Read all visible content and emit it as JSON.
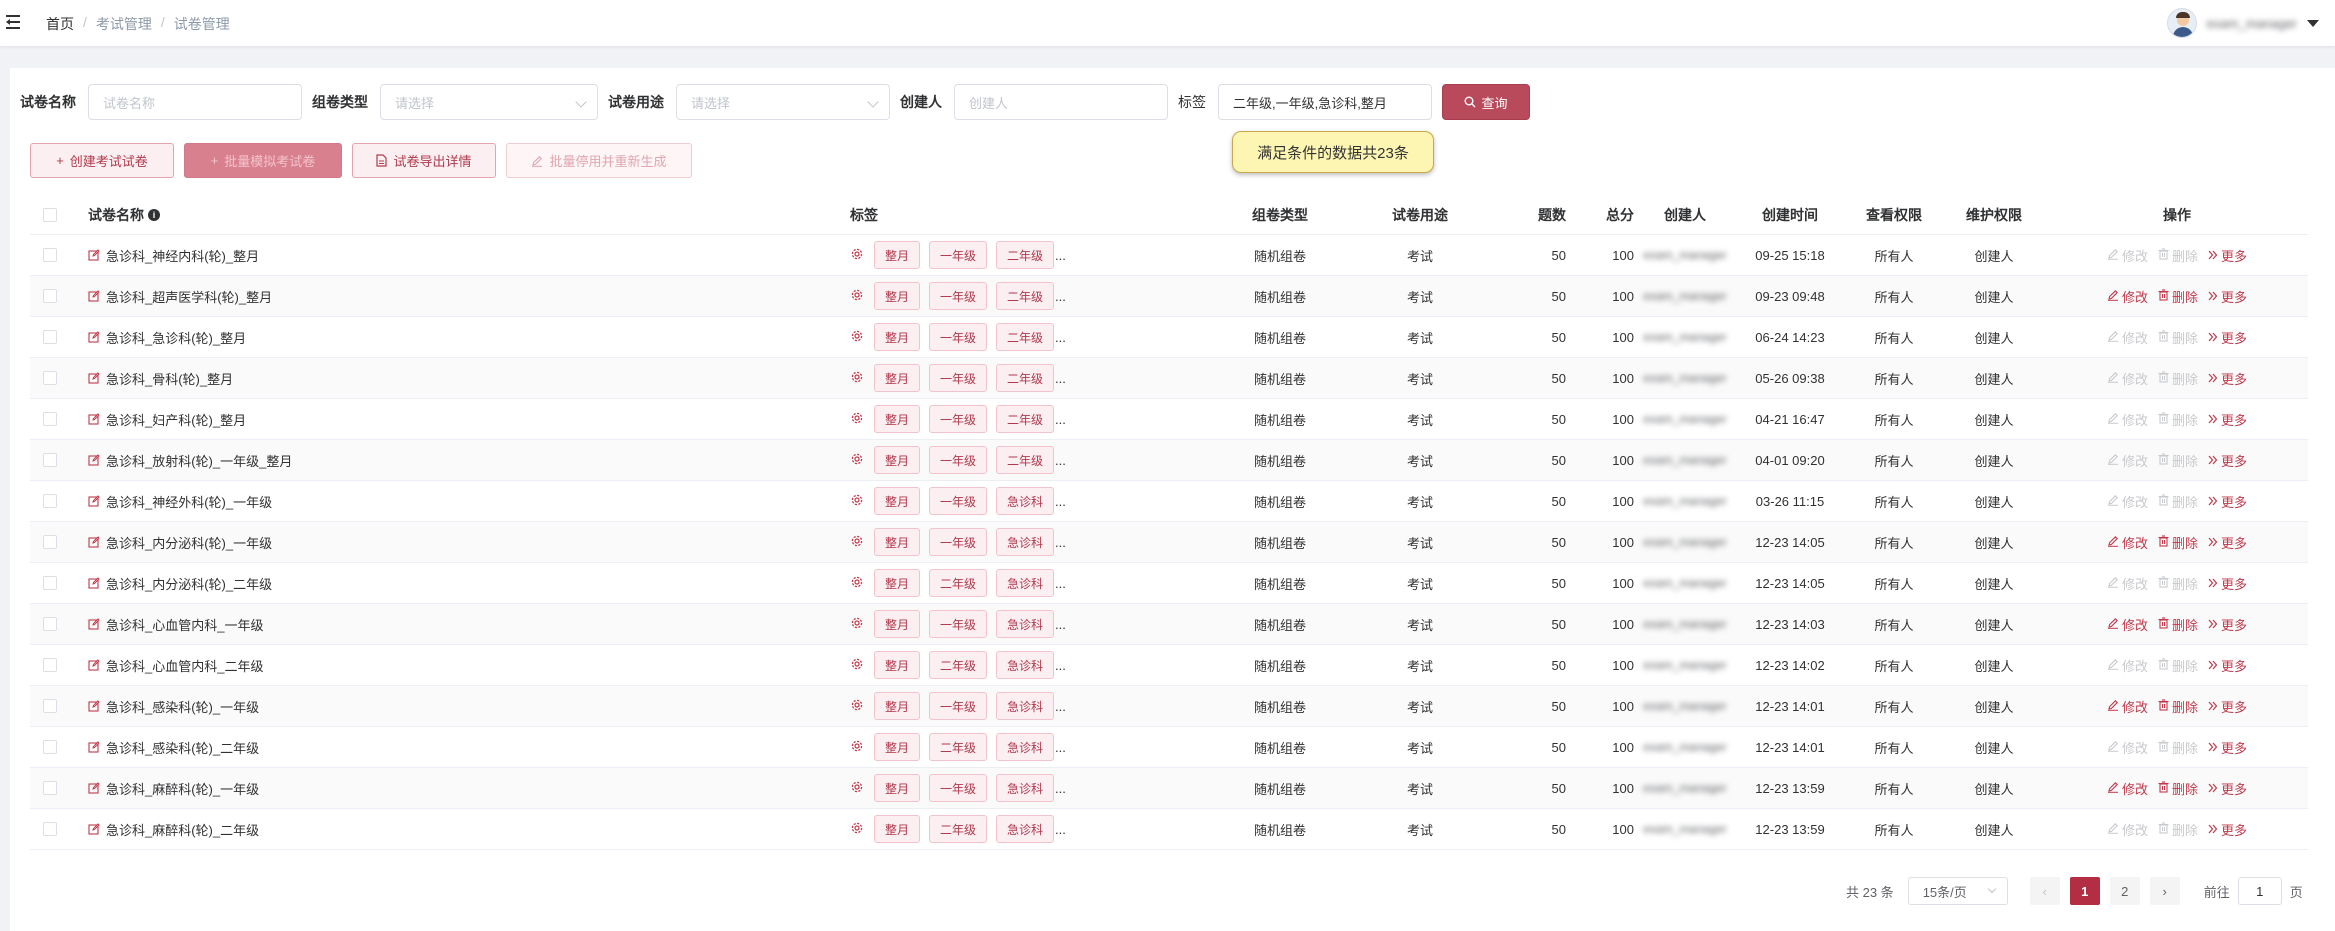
{
  "breadcrumb": {
    "home": "首页",
    "level1": "考试管理",
    "level2": "试卷管理"
  },
  "user": {
    "name": "exam_manager"
  },
  "filters": {
    "name_label": "试卷名称",
    "name_placeholder": "试卷名称",
    "compose_label": "组卷类型",
    "compose_placeholder": "请选择",
    "use_label": "试卷用途",
    "use_placeholder": "请选择",
    "creator_label": "创建人",
    "creator_placeholder": "创建人",
    "tag_label": "标签",
    "tag_value": "二年级,一年级,急诊科,整月",
    "query_label": "查询"
  },
  "tooltip": "满足条件的数据共23条",
  "actions": {
    "create_exam": "创建考试试卷",
    "create_mock": "批量模拟考试卷",
    "export": "试卷导出详情",
    "batch_disable": "批量停用并重新生成"
  },
  "columns": {
    "name": "试卷名称",
    "tags": "标签",
    "type": "组卷类型",
    "use": "试卷用途",
    "count": "题数",
    "score": "总分",
    "creator": "创建人",
    "time": "创建时间",
    "view": "查看权限",
    "maint": "维护权限",
    "ops": "操作"
  },
  "ops": {
    "edit": "修改",
    "delete": "删除",
    "more": "更多"
  },
  "rows": [
    {
      "name": "急诊科_神经内科(轮)_整月",
      "tags": [
        "整月",
        "一年级",
        "二年级"
      ],
      "ellipsis": "...",
      "type": "随机组卷",
      "use": "考试",
      "count": "50",
      "score": "100",
      "creator": "exam_manager",
      "time": "09-25 15:18",
      "view": "所有人",
      "maint": "创建人",
      "editable": false
    },
    {
      "name": "急诊科_超声医学科(轮)_整月",
      "tags": [
        "整月",
        "一年级",
        "二年级"
      ],
      "ellipsis": "...",
      "type": "随机组卷",
      "use": "考试",
      "count": "50",
      "score": "100",
      "creator": "exam_manager",
      "time": "09-23 09:48",
      "view": "所有人",
      "maint": "创建人",
      "editable": true
    },
    {
      "name": "急诊科_急诊科(轮)_整月",
      "tags": [
        "整月",
        "一年级",
        "二年级"
      ],
      "ellipsis": "...",
      "type": "随机组卷",
      "use": "考试",
      "count": "50",
      "score": "100",
      "creator": "exam_manager",
      "time": "06-24 14:23",
      "view": "所有人",
      "maint": "创建人",
      "editable": false
    },
    {
      "name": "急诊科_骨科(轮)_整月",
      "tags": [
        "整月",
        "一年级",
        "二年级"
      ],
      "ellipsis": "...",
      "type": "随机组卷",
      "use": "考试",
      "count": "50",
      "score": "100",
      "creator": "exam_manager",
      "time": "05-26 09:38",
      "view": "所有人",
      "maint": "创建人",
      "editable": false
    },
    {
      "name": "急诊科_妇产科(轮)_整月",
      "tags": [
        "整月",
        "一年级",
        "二年级"
      ],
      "ellipsis": "...",
      "type": "随机组卷",
      "use": "考试",
      "count": "50",
      "score": "100",
      "creator": "exam_manager",
      "time": "04-21 16:47",
      "view": "所有人",
      "maint": "创建人",
      "editable": false
    },
    {
      "name": "急诊科_放射科(轮)_一年级_整月",
      "tags": [
        "整月",
        "一年级",
        "二年级"
      ],
      "ellipsis": "...",
      "type": "随机组卷",
      "use": "考试",
      "count": "50",
      "score": "100",
      "creator": "exam_manager",
      "time": "04-01 09:20",
      "view": "所有人",
      "maint": "创建人",
      "editable": false
    },
    {
      "name": "急诊科_神经外科(轮)_一年级",
      "tags": [
        "整月",
        "一年级",
        "急诊科"
      ],
      "ellipsis": "...",
      "type": "随机组卷",
      "use": "考试",
      "count": "50",
      "score": "100",
      "creator": "exam_manager",
      "time": "03-26 11:15",
      "view": "所有人",
      "maint": "创建人",
      "editable": false
    },
    {
      "name": "急诊科_内分泌科(轮)_一年级",
      "tags": [
        "整月",
        "一年级",
        "急诊科"
      ],
      "ellipsis": "...",
      "type": "随机组卷",
      "use": "考试",
      "count": "50",
      "score": "100",
      "creator": "exam_manager",
      "time": "12-23 14:05",
      "view": "所有人",
      "maint": "创建人",
      "editable": true
    },
    {
      "name": "急诊科_内分泌科(轮)_二年级",
      "tags": [
        "整月",
        "二年级",
        "急诊科"
      ],
      "ellipsis": "...",
      "type": "随机组卷",
      "use": "考试",
      "count": "50",
      "score": "100",
      "creator": "exam_manager",
      "time": "12-23 14:05",
      "view": "所有人",
      "maint": "创建人",
      "editable": false
    },
    {
      "name": "急诊科_心血管内科_一年级",
      "tags": [
        "整月",
        "一年级",
        "急诊科"
      ],
      "ellipsis": "...",
      "type": "随机组卷",
      "use": "考试",
      "count": "50",
      "score": "100",
      "creator": "exam_manager",
      "time": "12-23 14:03",
      "view": "所有人",
      "maint": "创建人",
      "editable": true
    },
    {
      "name": "急诊科_心血管内科_二年级",
      "tags": [
        "整月",
        "二年级",
        "急诊科"
      ],
      "ellipsis": "...",
      "type": "随机组卷",
      "use": "考试",
      "count": "50",
      "score": "100",
      "creator": "exam_manager",
      "time": "12-23 14:02",
      "view": "所有人",
      "maint": "创建人",
      "editable": false
    },
    {
      "name": "急诊科_感染科(轮)_一年级",
      "tags": [
        "整月",
        "一年级",
        "急诊科"
      ],
      "ellipsis": "...",
      "type": "随机组卷",
      "use": "考试",
      "count": "50",
      "score": "100",
      "creator": "exam_manager",
      "time": "12-23 14:01",
      "view": "所有人",
      "maint": "创建人",
      "editable": true
    },
    {
      "name": "急诊科_感染科(轮)_二年级",
      "tags": [
        "整月",
        "二年级",
        "急诊科"
      ],
      "ellipsis": "...",
      "type": "随机组卷",
      "use": "考试",
      "count": "50",
      "score": "100",
      "creator": "exam_manager",
      "time": "12-23 14:01",
      "view": "所有人",
      "maint": "创建人",
      "editable": false
    },
    {
      "name": "急诊科_麻醉科(轮)_一年级",
      "tags": [
        "整月",
        "一年级",
        "急诊科"
      ],
      "ellipsis": "...",
      "type": "随机组卷",
      "use": "考试",
      "count": "50",
      "score": "100",
      "creator": "exam_manager",
      "time": "12-23 13:59",
      "view": "所有人",
      "maint": "创建人",
      "editable": true
    },
    {
      "name": "急诊科_麻醉科(轮)_二年级",
      "tags": [
        "整月",
        "二年级",
        "急诊科"
      ],
      "ellipsis": "...",
      "type": "随机组卷",
      "use": "考试",
      "count": "50",
      "score": "100",
      "creator": "exam_manager",
      "time": "12-23 13:59",
      "view": "所有人",
      "maint": "创建人",
      "editable": false
    }
  ],
  "pagination": {
    "total": "共 23 条",
    "page_size": "15条/页",
    "prev": "‹",
    "next": "›",
    "pages": [
      "1",
      "2"
    ],
    "current": "1",
    "goto_prefix": "前往",
    "goto_value": "1",
    "goto_suffix": "页"
  },
  "colors": {
    "accent": "#b32d43",
    "tag_bg": "#fbeff1",
    "tag_text": "#b03a4e"
  },
  "icons": {
    "menu": "hamburger-icon",
    "search": "search-icon",
    "edit": "edit-icon",
    "delete": "trash-icon",
    "more": "double-chevron-icon",
    "tag": "gear-icon",
    "info": "info-icon"
  }
}
